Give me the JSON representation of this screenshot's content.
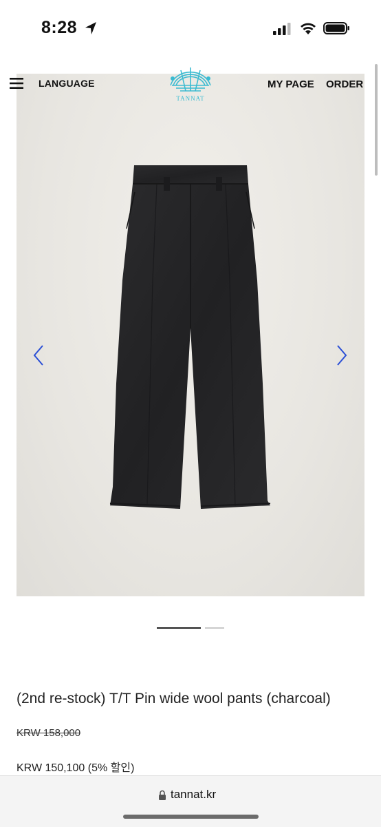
{
  "status_bar": {
    "time": "8:28",
    "icons": [
      "location-arrow-icon",
      "signal-icon",
      "wifi-icon",
      "battery-icon"
    ]
  },
  "header": {
    "menu_icon": "hamburger-icon",
    "language_label": "LANGUAGE",
    "logo_text": "TANNAT",
    "mypage_label": "MY PAGE",
    "order_label": "ORDER"
  },
  "carousel": {
    "prev_icon": "chevron-left-icon",
    "next_icon": "chevron-right-icon",
    "slide_count": 2,
    "active_slide": 1,
    "arrow_color": "#2a4fd6"
  },
  "product": {
    "title": "(2nd re-stock) T/T Pin wide wool pants (charcoal)",
    "original_price": "KRW 158,000",
    "sale_price": "KRW 150,100 (5% 할인)"
  },
  "browser": {
    "url": "tannat.kr",
    "lock_icon": "lock-icon"
  }
}
